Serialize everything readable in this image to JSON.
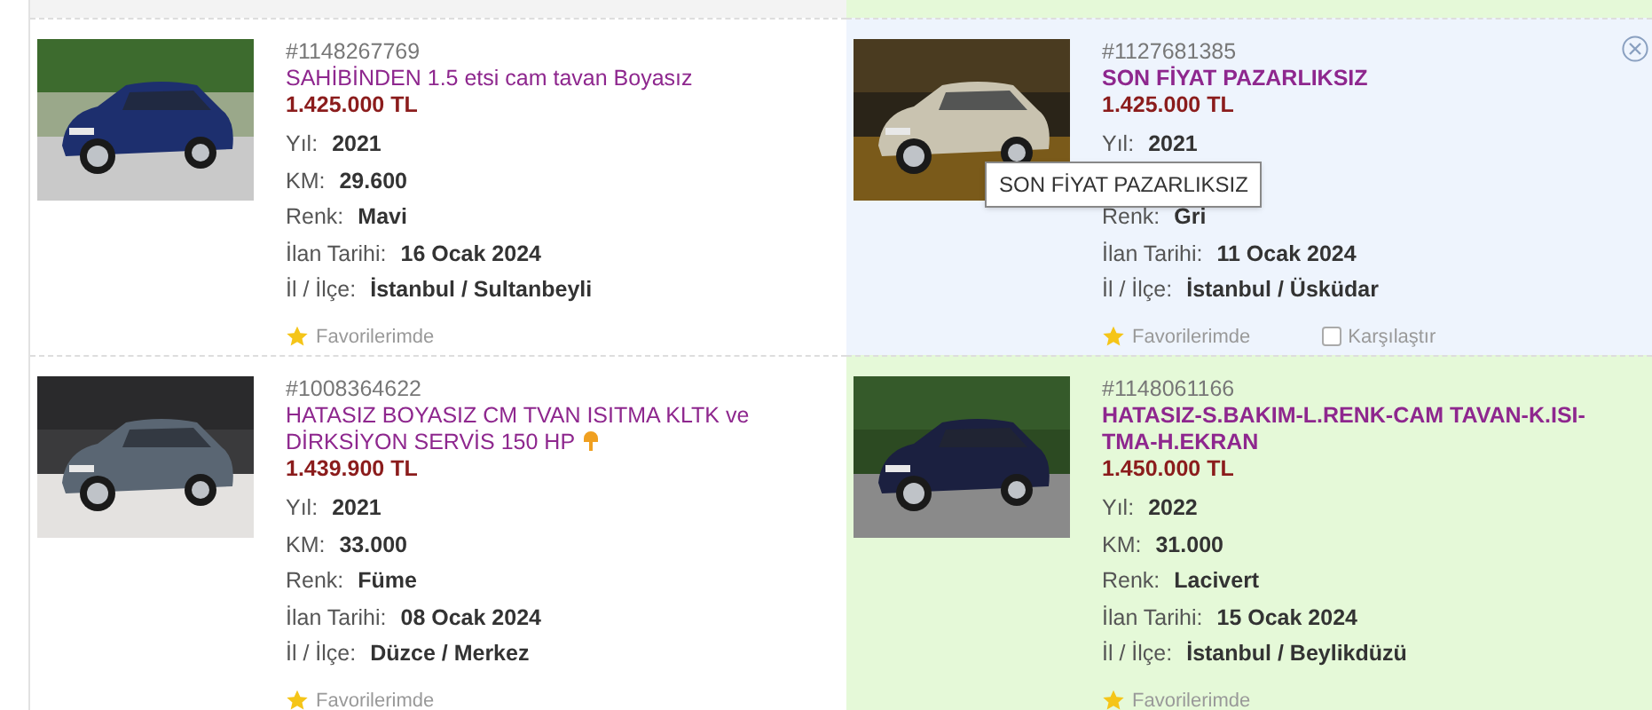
{
  "listings": [
    {
      "id": "#1148267769",
      "title": "SAHİBİNDEN 1.5 etsi cam tavan Boyasız",
      "bold": false,
      "badge": false,
      "price": "1.425.000 TL",
      "hovered": false,
      "featured": false,
      "specs": [
        {
          "kind": "spec",
          "label": "Yıl:",
          "value": "2021"
        },
        {
          "kind": "spec",
          "label": "KM:",
          "value": "29.600"
        },
        {
          "kind": "spec",
          "label": "Renk:",
          "value": "Mavi"
        },
        {
          "kind": "spec",
          "label": "İlan Tarihi:",
          "value": "16 Ocak 2024"
        },
        {
          "kind": "spec",
          "label": "İl / İlçe:",
          "value": "İstanbul / Sultanbeyli"
        }
      ],
      "favorite": "Favorilerimde"
    },
    {
      "id": "#1127681385",
      "title": "SON FİYAT PAZARLIKSIZ",
      "bold": true,
      "badge": false,
      "price": "1.425.000 TL",
      "hovered": true,
      "featured": false,
      "specs": [
        {
          "kind": "spec",
          "label": "Yıl:",
          "value": "2021"
        },
        {
          "kind": "tooltip",
          "text": "SON FİYAT PAZARLIKSIZ"
        },
        {
          "kind": "spec",
          "label": "Renk:",
          "value": "Gri"
        },
        {
          "kind": "spec",
          "label": "İlan Tarihi:",
          "value": "11 Ocak 2024"
        },
        {
          "kind": "spec",
          "label": "İl / İlçe:",
          "value": "İstanbul / Üsküdar"
        }
      ],
      "favorite": "Favorilerimde",
      "compare": {
        "label": "Karşılaştır",
        "checked": false
      }
    },
    {
      "id": "#1008364622",
      "title": "HATASIZ BOYASIZ CM TVAN ISITMA KLTK ve DİRKSİYON SERVİS 150 HP",
      "bold": false,
      "badge": true,
      "price": "1.439.900 TL",
      "hovered": false,
      "featured": false,
      "specs": [
        {
          "kind": "spec",
          "label": "Yıl:",
          "value": "2021"
        },
        {
          "kind": "spec",
          "label": "KM:",
          "value": "33.000"
        },
        {
          "kind": "spec",
          "label": "Renk:",
          "value": "Füme"
        },
        {
          "kind": "spec",
          "label": "İlan Tarihi:",
          "value": "08 Ocak 2024"
        },
        {
          "kind": "spec",
          "label": "İl / İlçe:",
          "value": "Düzce / Merkez"
        }
      ],
      "favorite": "Favorilerimde"
    },
    {
      "id": "#1148061166",
      "title": "HATASIZ-S.BAKIM-L.RENK-CAM TAVAN-K.ISI-TMA-H.EKRAN",
      "bold": true,
      "badge": false,
      "price": "1.450.000 TL",
      "hovered": false,
      "featured": true,
      "specs": [
        {
          "kind": "spec",
          "label": "Yıl:",
          "value": "2022"
        },
        {
          "kind": "spec",
          "label": "KM:",
          "value": "31.000"
        },
        {
          "kind": "spec",
          "label": "Renk:",
          "value": "Lacivert"
        },
        {
          "kind": "spec",
          "label": "İlan Tarihi:",
          "value": "15 Ocak 2024"
        },
        {
          "kind": "spec",
          "label": "İl / İlçe:",
          "value": "İstanbul / Beylikdüzü"
        }
      ],
      "favorite": "Favorilerimde"
    }
  ]
}
